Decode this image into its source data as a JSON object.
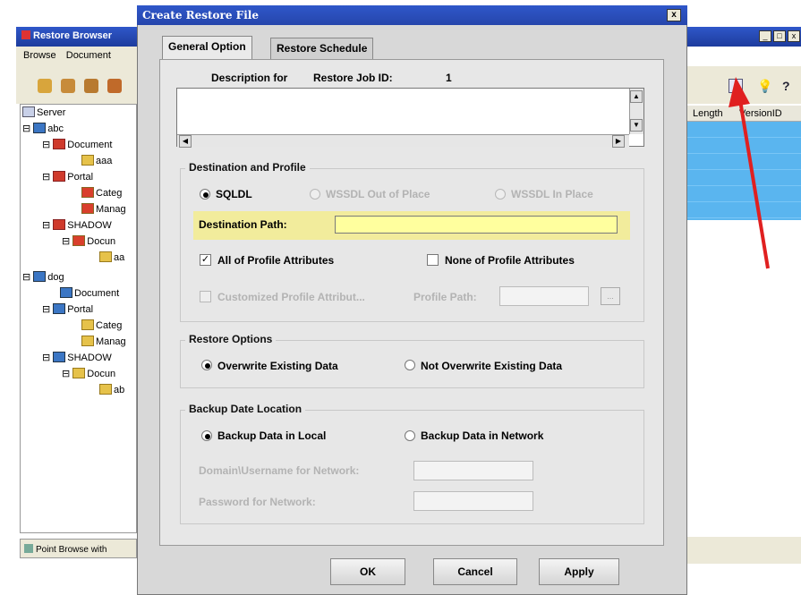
{
  "background_window": {
    "title": "Restore Browser",
    "menu": [
      "Browse",
      "Document"
    ],
    "tree": [
      {
        "label": "Server",
        "icon": "server-icon"
      },
      {
        "label": "abc",
        "icon": "database-icon"
      },
      {
        "label": "Document",
        "icon": "document-library-icon"
      },
      {
        "label": "aaa",
        "icon": "folder-icon"
      },
      {
        "label": "Portal",
        "icon": "portal-icon"
      },
      {
        "label": "Categ",
        "icon": "category-icon"
      },
      {
        "label": "Manag",
        "icon": "category-icon"
      },
      {
        "label": "SHADOW",
        "icon": "portal-icon"
      },
      {
        "label": "Docun",
        "icon": "folder-icon"
      },
      {
        "label": "aa",
        "icon": "folder-icon"
      },
      {
        "label": "dog",
        "icon": "database-icon"
      },
      {
        "label": "Document",
        "icon": "portal-icon"
      },
      {
        "label": "Portal",
        "icon": "portal-icon"
      },
      {
        "label": "Categ",
        "icon": "folder-icon"
      },
      {
        "label": "Manag",
        "icon": "folder-icon"
      },
      {
        "label": "SHADOW",
        "icon": "portal-icon"
      },
      {
        "label": "Docun",
        "icon": "folder-icon"
      },
      {
        "label": "ab",
        "icon": "folder-icon"
      }
    ],
    "status": "Point Browse with",
    "table_headers": [
      "Length",
      "VersionID"
    ]
  },
  "dialog": {
    "title": "Create Restore File",
    "close_label": "x",
    "tabs": [
      {
        "label": "General Option",
        "active": true
      },
      {
        "label": "Restore Schedule",
        "active": false
      }
    ],
    "description_label": "Description for",
    "job_id_label": "Restore Job ID:",
    "job_id_value": "1",
    "destination_group": {
      "title": "Destination and Profile",
      "radios": [
        {
          "label": "SQLDL",
          "selected": true,
          "enabled": true
        },
        {
          "label": "WSSDL Out of Place",
          "selected": false,
          "enabled": false
        },
        {
          "label": "WSSDL In Place",
          "selected": false,
          "enabled": false
        }
      ],
      "destination_path_label": "Destination Path:",
      "destination_path_value": "",
      "all_profile_label": "All of Profile Attributes",
      "all_profile_checked": true,
      "none_profile_label": "None of Profile Attributes",
      "none_profile_checked": false,
      "customized_label": "Customized Profile Attribut...",
      "profile_path_label": "Profile Path:",
      "browse_label": "..."
    },
    "restore_options": {
      "title": "Restore Options",
      "radios": [
        {
          "label": "Overwrite Existing Data",
          "selected": true
        },
        {
          "label": "Not Overwrite Existing Data",
          "selected": false
        }
      ]
    },
    "backup_location": {
      "title": "Backup Date Location",
      "radios": [
        {
          "label": "Backup Data in Local",
          "selected": true
        },
        {
          "label": "Backup Data in Network",
          "selected": false
        }
      ],
      "domain_label": "Domain\\Username for Network:",
      "password_label": "Password for Network:"
    },
    "buttons": {
      "ok": "OK",
      "cancel": "Cancel",
      "apply": "Apply"
    }
  },
  "colors": {
    "titlebar": "#2f57c9",
    "highlight": "#f2ec9c",
    "arrow": "#e02020",
    "table_selection": "#5ab5ef"
  }
}
